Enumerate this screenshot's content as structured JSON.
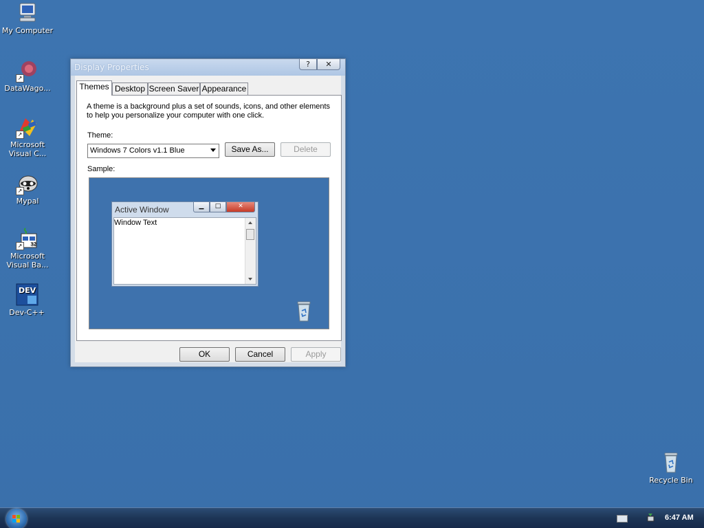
{
  "desktop": {
    "icons": [
      {
        "label": "My Computer",
        "icon": "my-computer-icon"
      },
      {
        "label": "DataWago...",
        "icon": "datawagon-icon"
      },
      {
        "label": "Microsoft Visual C...",
        "icon": "visual-cpp-icon"
      },
      {
        "label": "Mypal",
        "icon": "mypal-icon"
      },
      {
        "label": "Microsoft Visual Ba...",
        "icon": "visual-basic-icon"
      },
      {
        "label": "Dev-C++",
        "icon": "dev-cpp-icon",
        "badge": "DEV"
      },
      {
        "label": "Recycle Bin",
        "icon": "recycle-bin-icon"
      }
    ],
    "background_color": "#3a6ea5"
  },
  "dialog": {
    "title": "Display Properties",
    "help_label": "?",
    "close_label": "✕",
    "tabs": [
      {
        "label": "Themes",
        "active": true
      },
      {
        "label": "Desktop",
        "active": false
      },
      {
        "label": "Screen Saver",
        "active": false
      },
      {
        "label": "Appearance",
        "active": false
      }
    ],
    "themes_tab": {
      "description_line1": "A theme is a background plus a set of sounds, icons, and other elements",
      "description_line2": "to help you personalize your computer with one click.",
      "theme_label": "Theme:",
      "theme_value": "Windows 7 Colors v1.1 Blue",
      "save_as_label": "Save As...",
      "delete_label": "Delete",
      "sample_label": "Sample:",
      "sample": {
        "window_title": "Active Window",
        "window_text": "Window Text",
        "close_glyph": "✕",
        "min_glyph": "▁",
        "max_glyph": "□"
      }
    },
    "ok_label": "OK",
    "cancel_label": "Cancel",
    "apply_label": "Apply"
  },
  "taskbar": {
    "clock": "6:47 AM",
    "tray_icons": [
      "keyboard-icon",
      "network-icon"
    ]
  }
}
